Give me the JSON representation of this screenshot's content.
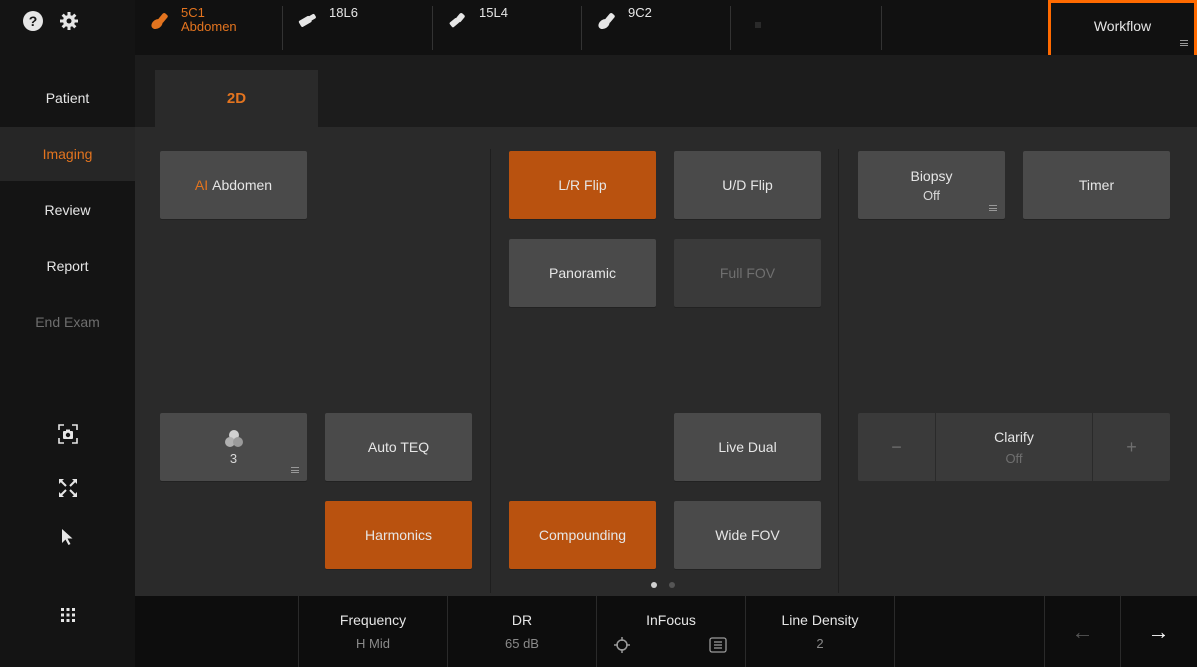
{
  "probes": [
    {
      "name": "5C1",
      "preset": "Abdomen",
      "active": true
    },
    {
      "name": "18L6",
      "preset": "",
      "active": false
    },
    {
      "name": "15L4",
      "preset": "",
      "active": false
    },
    {
      "name": "9C2",
      "preset": "",
      "active": false
    }
  ],
  "workflow_label": "Workflow",
  "sidebar": {
    "items": [
      {
        "label": "Patient",
        "state": "normal"
      },
      {
        "label": "Imaging",
        "state": "active"
      },
      {
        "label": "Review",
        "state": "normal"
      },
      {
        "label": "Report",
        "state": "normal"
      },
      {
        "label": "End Exam",
        "state": "disabled"
      }
    ]
  },
  "mode_tab": "2D",
  "buttons": {
    "ai_prefix": "AI",
    "ai_label": "Abdomen",
    "lr_flip": "L/R Flip",
    "ud_flip": "U/D Flip",
    "biopsy_label": "Biopsy",
    "biopsy_value": "Off",
    "timer": "Timer",
    "panoramic": "Panoramic",
    "full_fov": "Full FOV",
    "cluster_value": "3",
    "auto_teq": "Auto TEQ",
    "live_dual": "Live Dual",
    "clarify_label": "Clarify",
    "clarify_value": "Off",
    "clarify_minus": "−",
    "clarify_plus": "+",
    "harmonics": "Harmonics",
    "compounding": "Compounding",
    "wide_fov": "Wide FOV"
  },
  "bottom": {
    "frequency_label": "Frequency",
    "frequency_value": "H Mid",
    "dr_label": "DR",
    "dr_value": "65 dB",
    "infocus_label": "InFocus",
    "line_density_label": "Line Density",
    "line_density_value": "2",
    "back_arrow": "←",
    "forward_arrow": "→"
  },
  "colors": {
    "accent": "#e3741f",
    "active_button": "#b9520f",
    "workflow_highlight": "#ff6a00"
  },
  "page_indicator": {
    "pages": 2,
    "current": 1
  }
}
